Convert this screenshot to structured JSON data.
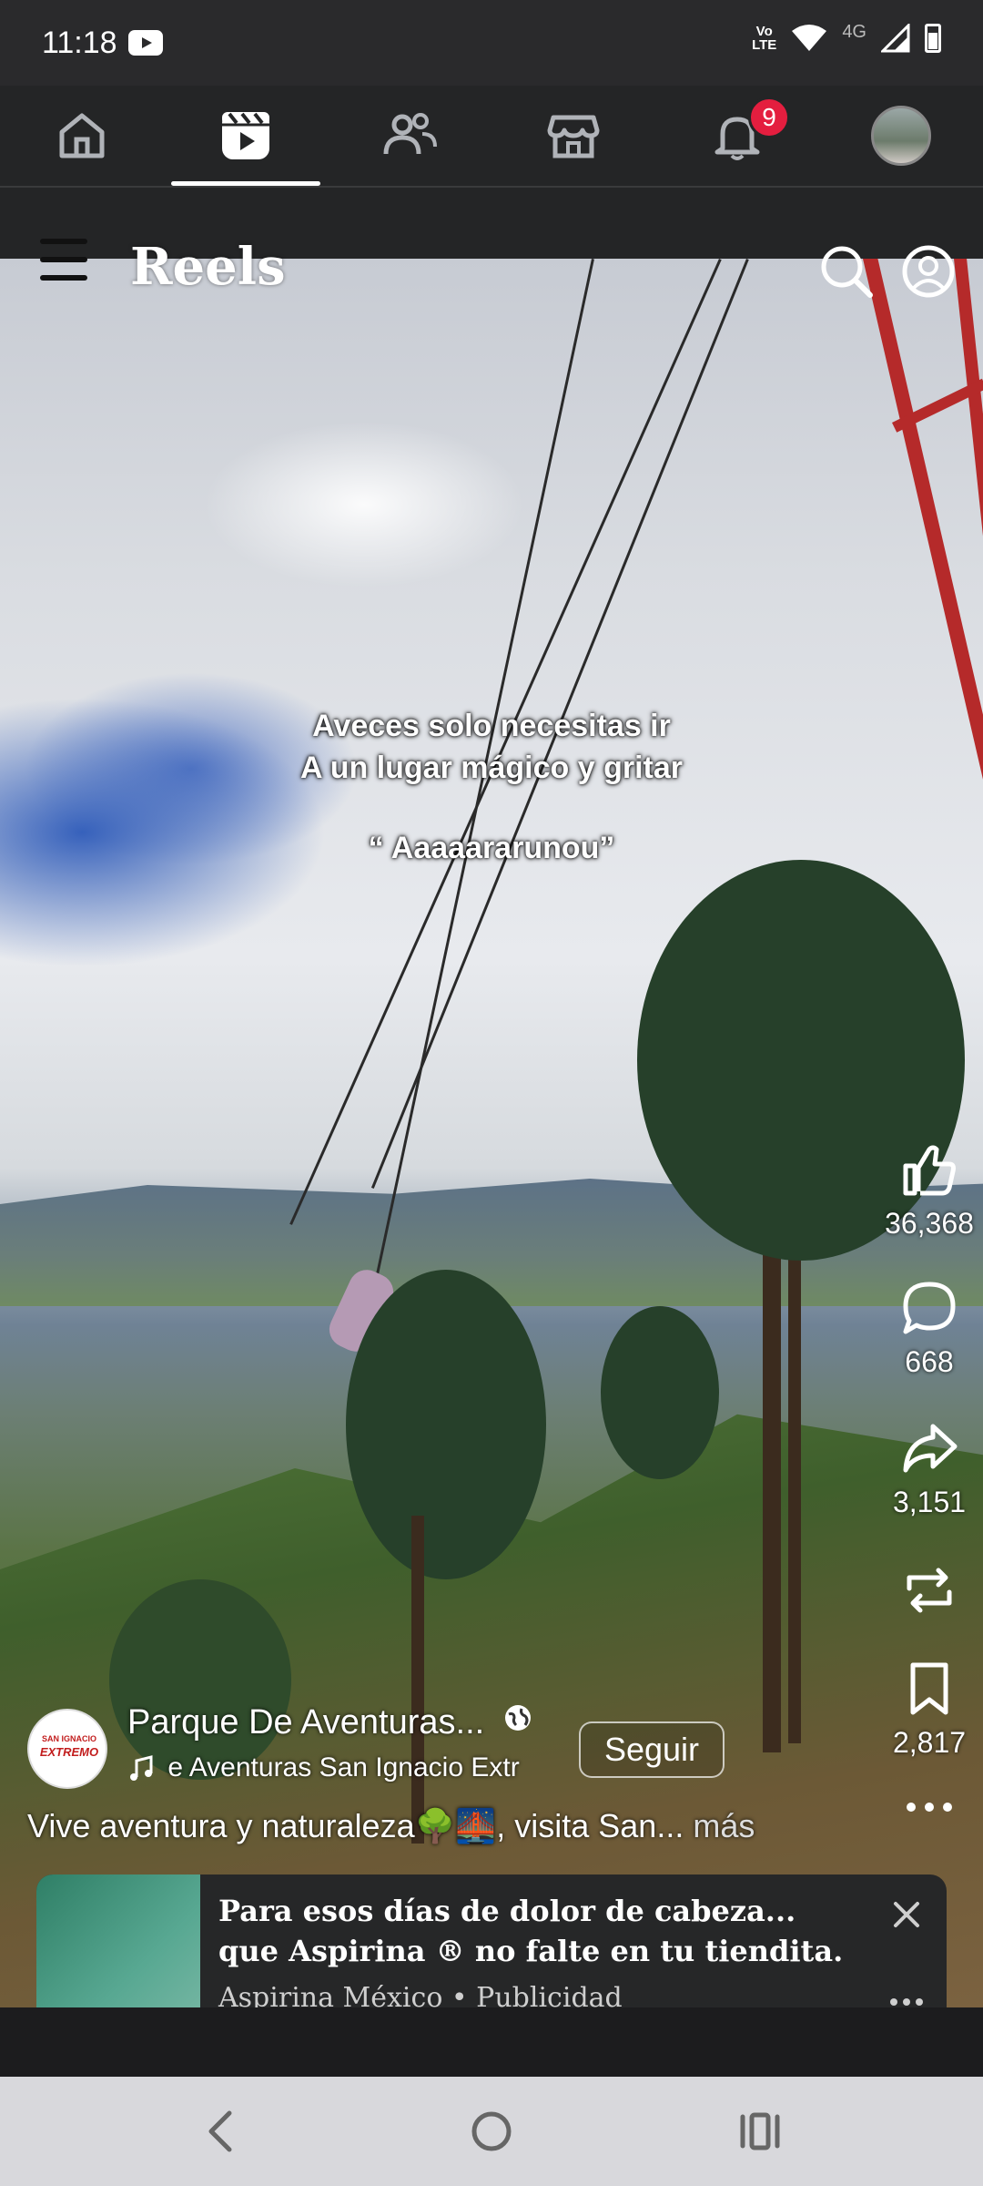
{
  "status_bar": {
    "time": "11:18",
    "network": "4G",
    "volte_line1": "Vo",
    "volte_line2": "LTE"
  },
  "nav": {
    "notifications_badge": "9"
  },
  "header": {
    "title": "Reels"
  },
  "video": {
    "caption_line1": "Aveces solo necesitas ir",
    "caption_line2": "A un lugar mágico y gritar",
    "caption_line3": "“ Aaaaararunou”"
  },
  "actions": {
    "likes": "36,368",
    "comments": "668",
    "shares": "3,151",
    "saves": "2,817"
  },
  "post": {
    "page_name": "Parque De Aventuras...",
    "avatar_logo_line1": "SAN IGNACIO",
    "avatar_logo_line2": "EXTREMO",
    "follow_label": "Seguir",
    "music": "e Aventuras San Ignacio Extr",
    "description": "Vive aventura y naturaleza🌳🌉, visita San...",
    "more_label": " más"
  },
  "ad": {
    "title": "Para esos días de dolor de cabeza... que Aspirina ® no falte en tu tiendita.",
    "advertiser": "Aspirina México • Publicidad"
  },
  "colors": {
    "badge": "#e41e3f",
    "nav_bg": "#242526"
  }
}
